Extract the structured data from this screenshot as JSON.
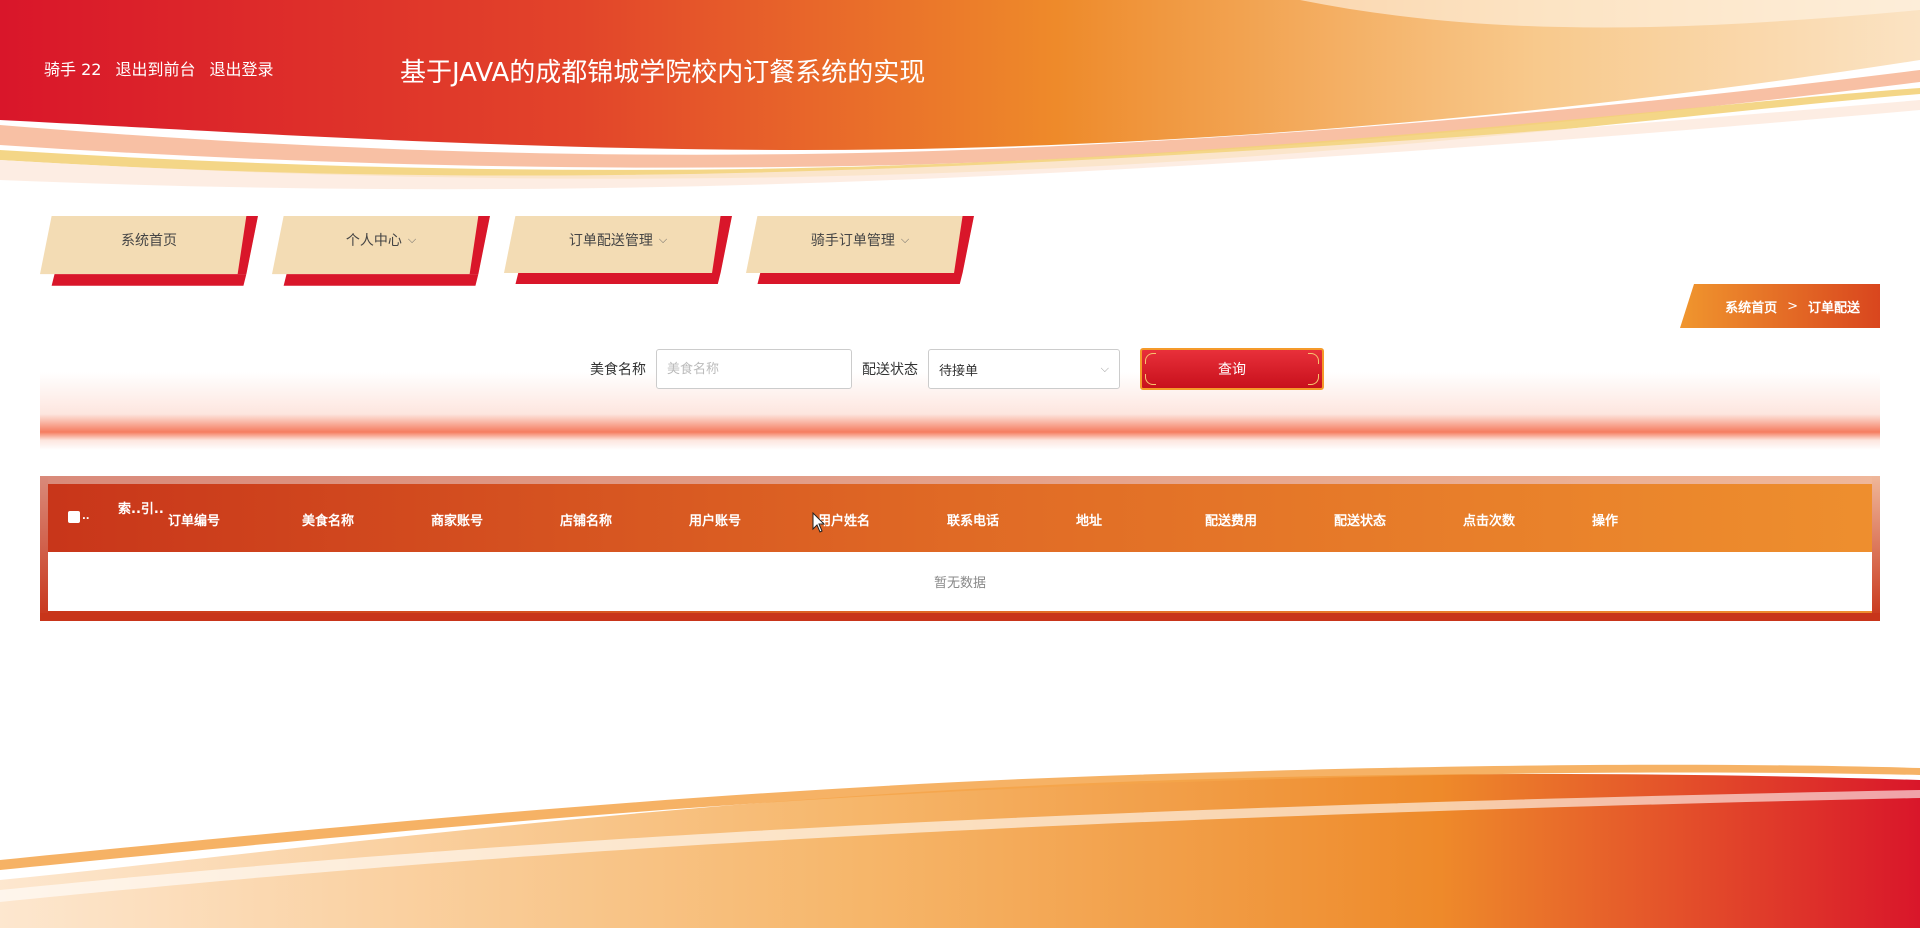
{
  "header": {
    "user_label": "骑手 22",
    "back_to_front": "退出到前台",
    "logout": "退出登录",
    "title": "基于JAVA的成都锦城学院校内订餐系统的实现"
  },
  "nav": {
    "items": [
      {
        "label": "系统首页",
        "has_dropdown": false
      },
      {
        "label": "个人中心",
        "has_dropdown": true
      },
      {
        "label": "订单配送管理",
        "has_dropdown": true
      },
      {
        "label": "骑手订单管理",
        "has_dropdown": true
      }
    ],
    "chevron": "⌵"
  },
  "breadcrumb": {
    "home": "系统首页",
    "separator": ">",
    "current": "订单配送"
  },
  "search": {
    "food_name_label": "美食名称",
    "food_name_placeholder": "美食名称",
    "food_name_value": "",
    "status_label": "配送状态",
    "status_value": "待接单",
    "query_button": "查询"
  },
  "table": {
    "check_dots": "..",
    "index_header": "索..引..",
    "columns": [
      "订单编号",
      "美食名称",
      "商家账号",
      "店铺名称",
      "用户账号",
      "用户姓名",
      "联系电话",
      "地址",
      "配送费用",
      "配送状态",
      "点击次数",
      "操作"
    ],
    "empty_text": "暂无数据"
  },
  "colors": {
    "primary_red": "#d9162a",
    "accent_orange": "#ee8f2e",
    "nav_tan": "#f3dcb4"
  }
}
